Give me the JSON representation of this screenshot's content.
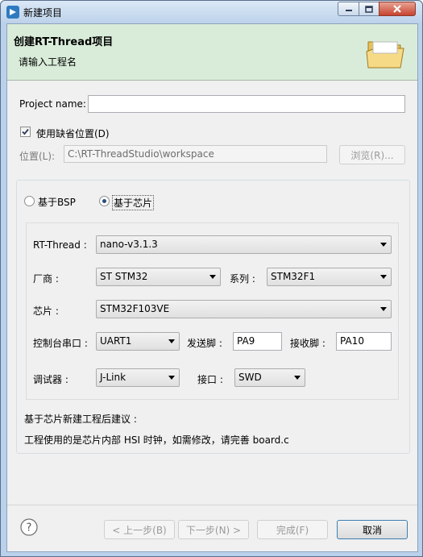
{
  "window": {
    "title": "新建项目"
  },
  "header": {
    "title": "创建RT-Thread项目",
    "subtitle": "请输入工程名"
  },
  "project": {
    "name_label": "Project name:",
    "name_value": ""
  },
  "location": {
    "use_default_label": "使用缺省位置(D)",
    "use_default_checked": true,
    "path_label": "位置(L):",
    "path_value": "C:\\RT-ThreadStudio\\workspace",
    "browse_label": "浏览(R)..."
  },
  "mode": {
    "bsp_label": "基于BSP",
    "chip_label": "基于芯片",
    "selected": "chip"
  },
  "chip_form": {
    "rtthread_label": "RT-Thread :",
    "rtthread_value": "nano-v3.1.3",
    "vendor_label": "厂商 :",
    "vendor_value": "ST STM32",
    "series_label": "系列 :",
    "series_value": "STM32F1",
    "chip_label": "芯片 :",
    "chip_value": "STM32F103VE",
    "console_label": "控制台串口 :",
    "console_value": "UART1",
    "tx_label": "发送脚 :",
    "tx_value": "PA9",
    "rx_label": "接收脚 :",
    "rx_value": "PA10",
    "debugger_label": "调试器 :",
    "debugger_value": "J-Link",
    "interface_label": "接口 :",
    "interface_value": "SWD"
  },
  "advice": {
    "title": "基于芯片新建工程后建议 :",
    "text": "工程使用的是芯片内部 HSI 时钟，如需修改，请完善 board.c"
  },
  "footer": {
    "back": "< 上一步(B)",
    "next": "下一步(N) >",
    "finish": "完成(F)",
    "cancel": "取消"
  },
  "colors": {
    "header_bg": "#d9ecd9",
    "accent": "#2a4d7a",
    "titlebar": "#bcd2ea"
  }
}
